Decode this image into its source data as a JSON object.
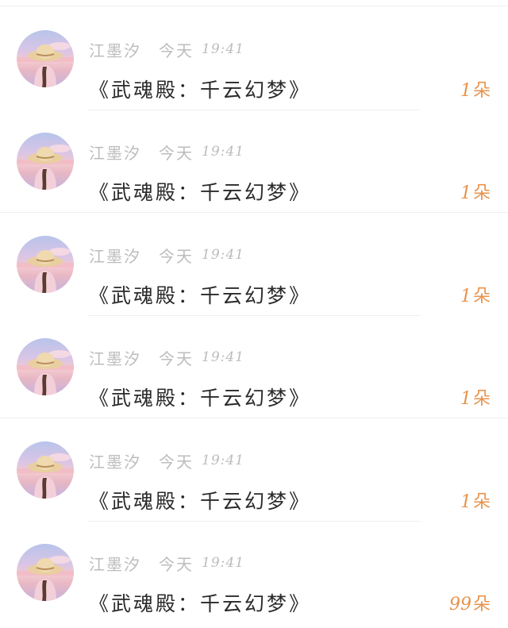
{
  "messages": [
    {
      "user": "江墨汐",
      "day": "今天",
      "time": "19:41",
      "text": "《武魂殿：千云幻梦》",
      "count": "1",
      "unit": "朵"
    },
    {
      "user": "江墨汐",
      "day": "今天",
      "time": "19:41",
      "text": "《武魂殿：千云幻梦》",
      "count": "1",
      "unit": "朵"
    },
    {
      "user": "江墨汐",
      "day": "今天",
      "time": "19:41",
      "text": "《武魂殿：千云幻梦》",
      "count": "1",
      "unit": "朵"
    },
    {
      "user": "江墨汐",
      "day": "今天",
      "time": "19:41",
      "text": "《武魂殿：千云幻梦》",
      "count": "1",
      "unit": "朵"
    },
    {
      "user": "江墨汐",
      "day": "今天",
      "time": "19:41",
      "text": "《武魂殿：千云幻梦》",
      "count": "1",
      "unit": "朵"
    },
    {
      "user": "江墨汐",
      "day": "今天",
      "time": "19:41",
      "text": "《武魂殿：千云幻梦》",
      "count": "99",
      "unit": "朵"
    }
  ],
  "colors": {
    "meta_text": "#bcbcbc",
    "message_text": "#2a2a2a",
    "count_accent": "#e8934b"
  },
  "icons": {
    "avatar": "avatar-girl-straw-hat-icon"
  }
}
